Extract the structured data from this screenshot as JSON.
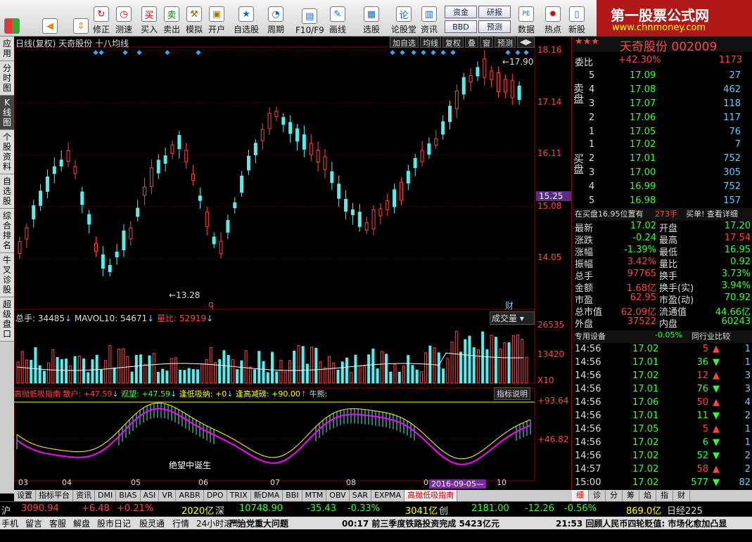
{
  "toolbar": {
    "items": [
      "修正",
      "测速",
      "买入",
      "卖出",
      "模拟",
      "开户",
      "自选股",
      "周期",
      "F10/F9",
      "画线",
      "选股",
      "论股堂",
      "资讯",
      "数据",
      "热点",
      "新股"
    ],
    "small": [
      "资金",
      "研报",
      "BBD",
      "预测"
    ]
  },
  "logo": {
    "title": "第一股票公式网",
    "url": "www.chnmoney.com"
  },
  "left_tabs": [
    "应用",
    "分时图",
    "K线图",
    "个股资料",
    "自选股",
    "综合排名",
    "牛叉诊股",
    "超级盘口"
  ],
  "chart": {
    "title": "日线(复权) 天奇股份 十八均线",
    "buttons": [
      "加自选",
      "均线",
      "复权",
      "叠",
      "窗",
      "预测"
    ],
    "price_labels": [
      "18.16",
      "17.14",
      "16.11",
      "15.08",
      "14.05"
    ],
    "current_price": "15.25",
    "high_label": "17.90",
    "low_label": "13.28",
    "vol_title": "总手: 34485",
    "vol_ma": "MAVOL10: 54671",
    "vol_ratio": "量比: 52919",
    "vol_selector": "成交量",
    "vol_labels": [
      "26535",
      "13420",
      "X10"
    ],
    "ind_name": "高抛低吸指南",
    "ind_a": "散户: +47.59",
    "ind_b": "观望: +47.59",
    "ind_c": "逢低吸纳: +0",
    "ind_d": "逢高减磅: +90.00",
    "ind_e": "牛熊:",
    "ind_help": "指标说明",
    "ind_labels": [
      "+93.64",
      "+46.82"
    ],
    "ind_note": "绝望中诞生",
    "months": [
      "03",
      "04",
      "05",
      "06",
      "07",
      "08",
      "09",
      "10"
    ],
    "date_tag": "2016-09-05",
    "marker_q": "q",
    "marker_cai": "财"
  },
  "bottom_tabs": [
    "设置",
    "指标平台",
    "资讯",
    "DMI",
    "BIAS",
    "ASI",
    "VR",
    "ARBR",
    "DPO",
    "TRIX",
    "新DMA",
    "BBI",
    "MTM",
    "OBV",
    "SAR",
    "EXPMA",
    "高抛低吸指南"
  ],
  "quote": {
    "name": "天奇股份 002009",
    "weibi_label": "委比",
    "weibi": "+42.30%",
    "weicha": "1173",
    "sell": [
      [
        "5",
        "17.09",
        "27"
      ],
      [
        "4",
        "17.08",
        "462"
      ],
      [
        "3",
        "17.07",
        "118"
      ],
      [
        "2",
        "17.06",
        "117"
      ],
      [
        "1",
        "17.05",
        "76"
      ]
    ],
    "buy": [
      [
        "1",
        "17.02",
        "7"
      ],
      [
        "2",
        "17.01",
        "752"
      ],
      [
        "3",
        "17.00",
        "305"
      ],
      [
        "4",
        "16.99",
        "752"
      ],
      [
        "5",
        "16.98",
        "157"
      ]
    ],
    "sell_label": "卖盘",
    "buy_label": "买盘",
    "notice": "在买盘16.95位置有",
    "notice_num": "273手",
    "notice_tail": "买单! 查看详细",
    "stats": [
      [
        "最新",
        "17.02",
        "开盘",
        "17.20"
      ],
      [
        "涨跌",
        "-0.24",
        "最高",
        "17.54"
      ],
      [
        "涨幅",
        "-1.39%",
        "最低",
        "16.95"
      ],
      [
        "振幅",
        "3.42%",
        "量比",
        "0.92"
      ],
      [
        "总手",
        "97765",
        "换手",
        "3.73%"
      ],
      [
        "金额",
        "1.68亿",
        "换手(实)",
        "3.94%"
      ],
      [
        "市盈",
        "62.95",
        "市盈(动)",
        "70.92"
      ],
      [
        "总市值",
        "62.09亿",
        "流通值",
        "44.66亿"
      ],
      [
        "外盘",
        "37522",
        "内盘",
        "60243"
      ]
    ],
    "equip": "专用设备",
    "equip_pct": "-0.05%",
    "compare": "同行业比较",
    "ticks": [
      [
        "14:56",
        "17.02",
        "5",
        "1"
      ],
      [
        "14:56",
        "17.01",
        "36",
        "1"
      ],
      [
        "14:56",
        "17.02",
        "12",
        "3"
      ],
      [
        "14:56",
        "17.01",
        "76",
        "3"
      ],
      [
        "14:56",
        "17.06",
        "50",
        "4"
      ],
      [
        "14:56",
        "17.01",
        "11",
        "2"
      ],
      [
        "14:56",
        "17.05",
        "5",
        "1"
      ],
      [
        "14:56",
        "17.02",
        "6",
        "1"
      ],
      [
        "14:56",
        "17.02",
        "52",
        "2"
      ],
      [
        "14:57",
        "17.02",
        "58",
        "2"
      ],
      [
        "15:00",
        "17.02",
        "577",
        "82"
      ]
    ],
    "tabs": [
      "细",
      "诊",
      "分",
      "筹",
      "焰",
      "指",
      "财"
    ]
  },
  "index_bar": {
    "hu": "沪",
    "hu_val": "3090.94",
    "hu_chg": "+6.48",
    "hu_pct": "+0.21%",
    "hu_amt": "2020亿",
    "shen": "深",
    "shen_val": "10748.90",
    "shen_chg": "-35.43",
    "shen_pct": "-0.33%",
    "shen_amt": "3041亿",
    "chuang": "创",
    "chuang_val": "2181.00",
    "chuang_chg": "-12.26",
    "chuang_pct": "-0.56%",
    "chuang_amt": "869.0亿",
    "rijing": "日经225"
  },
  "status": {
    "items": [
      "手机",
      "留言",
      "客服",
      "解盘",
      "股市日记",
      "股灵通",
      "行情",
      "24小时滚动"
    ],
    "news1": "严治党重大问题",
    "news2": "00:17 前三季度铁路投资完成 5423亿元",
    "news3": "21:53 回顾人民币四轮贬值: 市场化愈加凸显"
  }
}
